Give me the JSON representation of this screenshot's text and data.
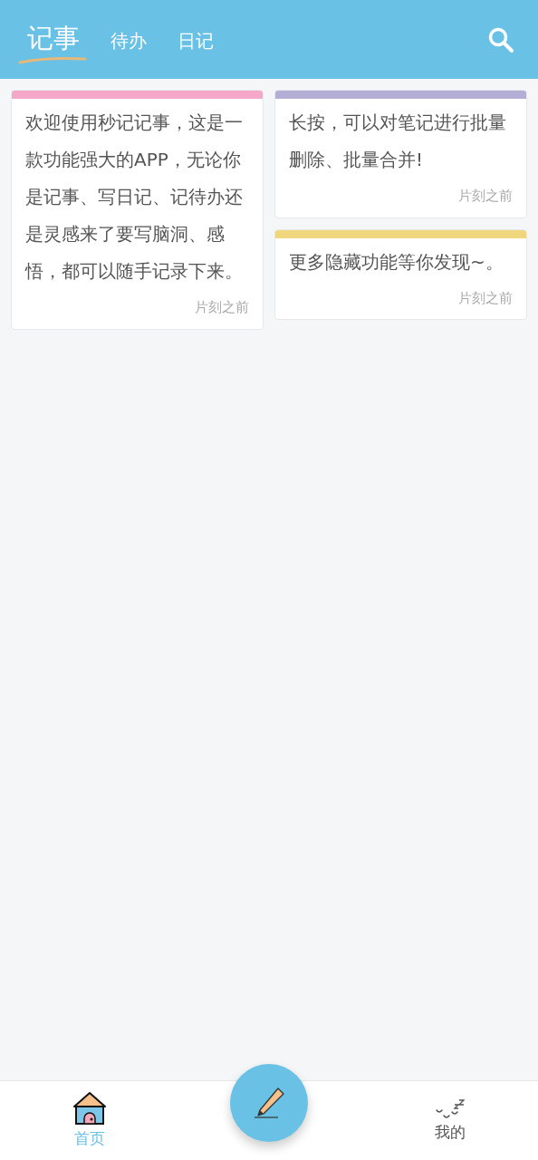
{
  "tabs": [
    {
      "label": "记事",
      "selected": true
    },
    {
      "label": "待办",
      "selected": false
    },
    {
      "label": "日记",
      "selected": false
    }
  ],
  "columns": [
    [
      {
        "color": "#f4a7c8",
        "text": "欢迎使用秒记记事，这是一款功能强大的APP，无论你是记事、写日记、记待办还是灵感来了要写脑洞、感悟，都可以随手记录下来。",
        "time": "片刻之前"
      }
    ],
    [
      {
        "color": "#b2aed6",
        "text": "长按，可以对笔记进行批量删除、批量合并!",
        "time": "片刻之前"
      },
      {
        "color": "#f0d77e",
        "text": "更多隐藏功能等你发现~。",
        "time": "片刻之前"
      }
    ]
  ],
  "nav": [
    {
      "label": "首页",
      "selected": true
    },
    {
      "label": "我的",
      "selected": false
    }
  ]
}
